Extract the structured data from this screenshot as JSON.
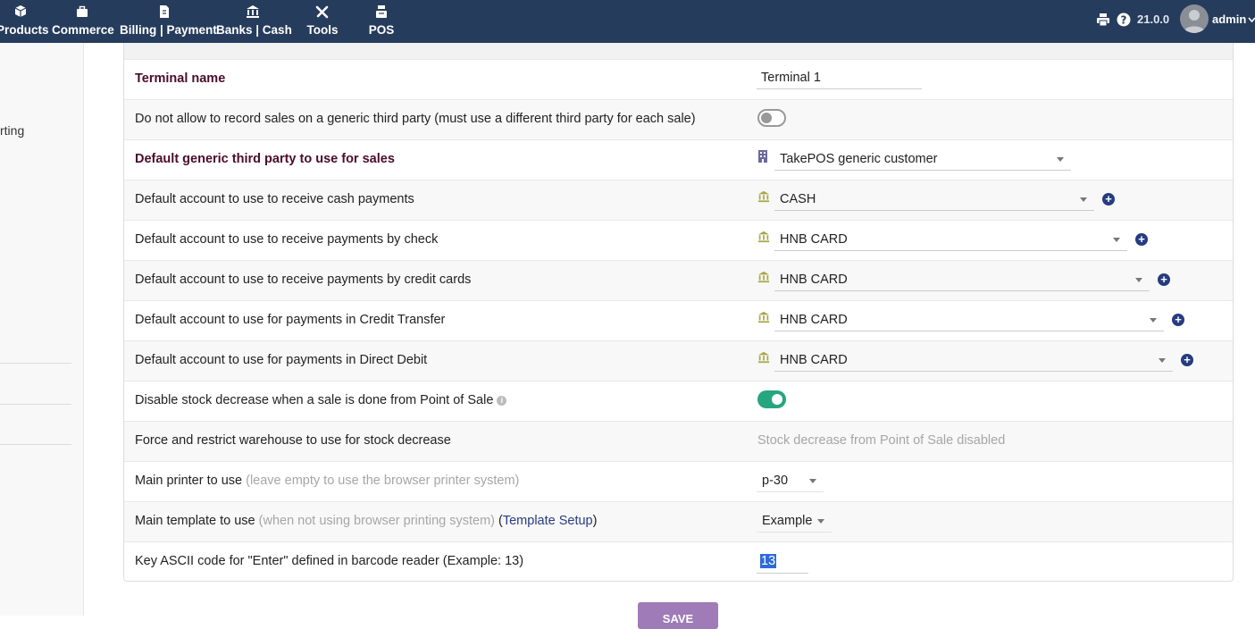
{
  "topbar": {
    "menu": [
      {
        "label": "Products",
        "icon": "cube-icon"
      },
      {
        "label": "Commerce",
        "icon": "briefcase-icon"
      },
      {
        "label": "Billing | Payment",
        "icon": "invoice-icon"
      },
      {
        "label": "Banks | Cash",
        "icon": "bank-icon"
      },
      {
        "label": "Tools",
        "icon": "tools-icon"
      },
      {
        "label": "POS",
        "icon": "cash-register-icon"
      }
    ],
    "version": "21.0.0",
    "user": "admin"
  },
  "sidebar": {
    "partial_label": "rting"
  },
  "form": {
    "terminal_name": {
      "label": "Terminal name",
      "value": "Terminal 1"
    },
    "no_generic_third_party": {
      "label": "Do not allow to record sales on a generic third party (must use a different third party for each sale)",
      "enabled": false
    },
    "default_third_party": {
      "label": "Default generic third party to use for sales",
      "value": "TakePOS generic customer"
    },
    "cash_account": {
      "label": "Default account to use to receive cash payments",
      "value": "CASH"
    },
    "check_account": {
      "label": "Default account to use to receive payments by check",
      "value": "HNB CARD"
    },
    "card_account": {
      "label": "Default account to use to receive payments by credit cards",
      "value": "HNB CARD"
    },
    "transfer_account": {
      "label": "Default account to use for payments in Credit Transfer",
      "value": "HNB CARD"
    },
    "debit_account": {
      "label": "Default account to use for payments in Direct Debit",
      "value": "HNB CARD"
    },
    "disable_stock": {
      "label": "Disable stock decrease when a sale is done from Point of Sale",
      "enabled": true
    },
    "warehouse": {
      "label": "Force and restrict warehouse to use for stock decrease",
      "value": "Stock decrease from Point of Sale disabled"
    },
    "printer": {
      "label": "Main printer to use",
      "hint": "(leave empty to use the browser printer system)",
      "value": "p-30"
    },
    "template": {
      "label": "Main template to use",
      "hint": "(when not using browser printing system)",
      "link_open": "(",
      "link": "Template Setup",
      "link_close": ")",
      "value": "Example"
    },
    "ascii": {
      "label": "Key ASCII code for \"Enter\" defined in barcode reader (Example: 13)",
      "value": "13"
    }
  },
  "save_label": "SAVE",
  "colors": {
    "topbar": "#263c5c",
    "accent_label": "#4a0b2c",
    "toggle_on": "#25a580",
    "button": "#9f7bb7"
  }
}
